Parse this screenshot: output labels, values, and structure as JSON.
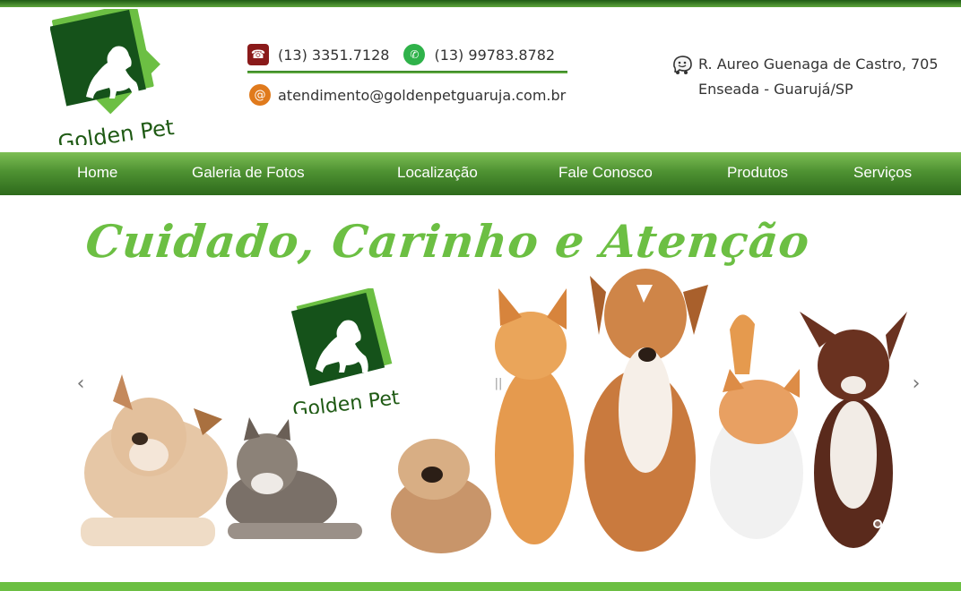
{
  "brand": {
    "name": "Golden Pet"
  },
  "contact": {
    "phone": "(13) 3351.7128",
    "whatsapp": "(13) 99783.8782",
    "email": "atendimento@goldenpetguaruja.com.br"
  },
  "address": {
    "line1": "R. Aureo Guenaga de Castro, 705",
    "line2": "Enseada - Guarujá/SP"
  },
  "nav": {
    "items": [
      {
        "label": "Home"
      },
      {
        "label": "Galeria de Fotos"
      },
      {
        "label": "Localização"
      },
      {
        "label": "Fale Conosco"
      },
      {
        "label": "Produtos"
      },
      {
        "label": "Serviços"
      }
    ]
  },
  "banner": {
    "headline": "Cuidado, Carinho e Atenção",
    "logo_text": "Golden Pet",
    "slide_count": 2,
    "active_slide": 2
  },
  "icons": {
    "phone": "telephone-icon",
    "whatsapp": "whatsapp-icon",
    "email": "at-sign-icon",
    "address": "waze-icon",
    "prev": "chevron-left-icon",
    "next": "chevron-right-icon",
    "pause": "pause-icon"
  },
  "colors": {
    "brand_green": "#6cbf43",
    "dark_green": "#1f5a14",
    "nav_top": "#7dbe54",
    "nav_bottom": "#2e6a1c"
  }
}
